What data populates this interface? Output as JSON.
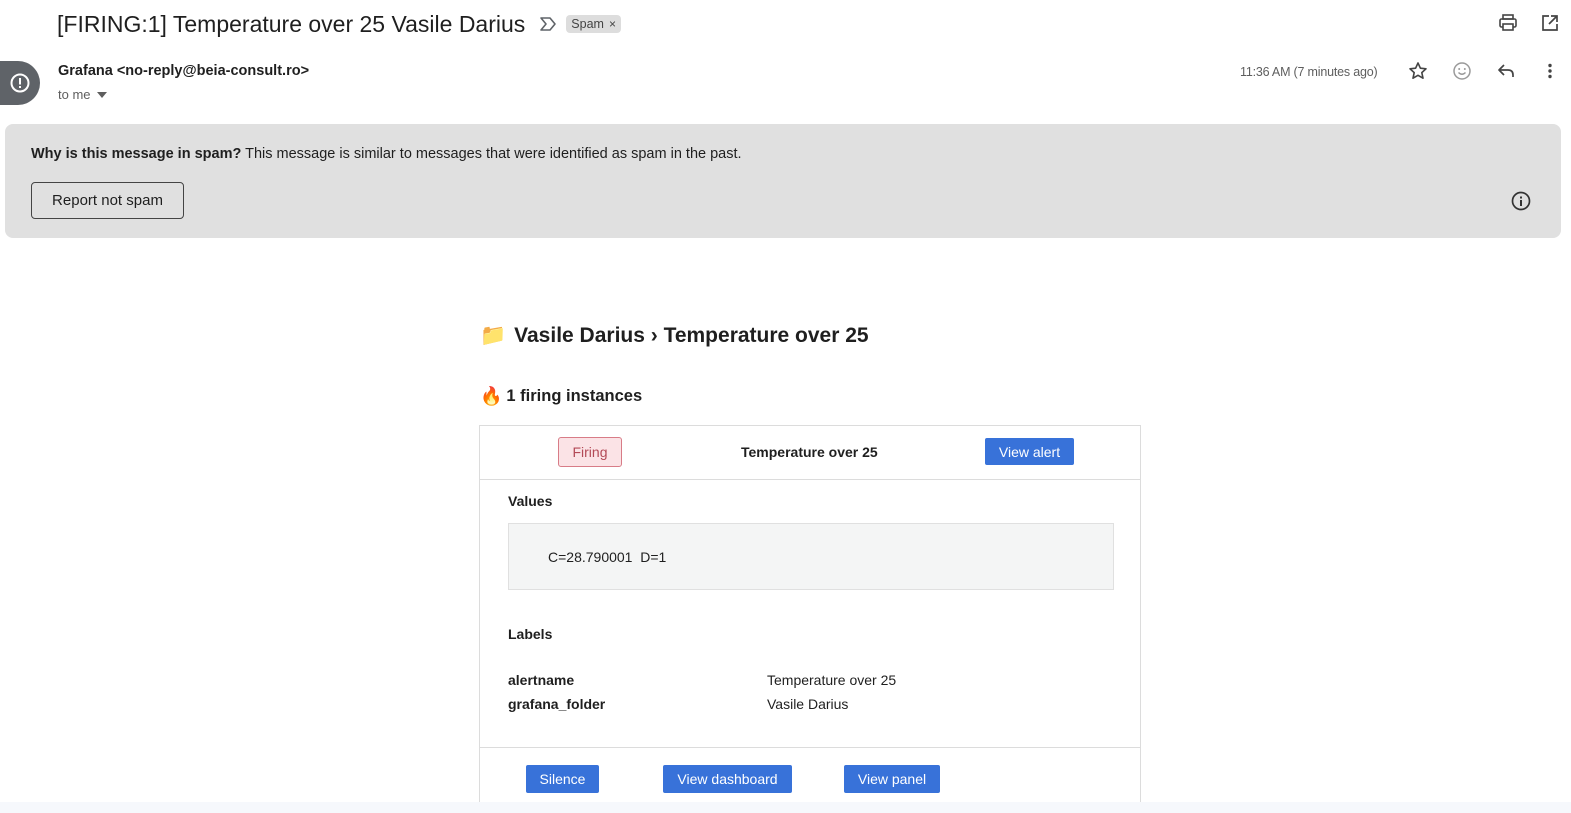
{
  "subject": {
    "text": "[FIRING:1] Temperature over 25 Vasile Darius",
    "label_chip": "Spam",
    "label_chip_close": "×"
  },
  "sender": {
    "name_email": "Grafana <no-reply@beia-consult.ro>",
    "recipient": "to me",
    "timestamp": "11:36 AM (7 minutes ago)"
  },
  "spam_banner": {
    "question": "Why is this message in spam?",
    "explanation": " This message is similar to messages that were identified as spam in the past.",
    "report_button": "Report not spam"
  },
  "email": {
    "title": "Vasile Darius › Temperature over 25",
    "title_emoji": "📁",
    "firing_emoji": "🔥",
    "firing_count": "1 firing instances",
    "alert": {
      "status": "Firing",
      "name": "Temperature over 25",
      "view_alert": "View alert",
      "values_heading": "Values",
      "values": "C=28.790001  D=1",
      "labels_heading": "Labels",
      "labels": [
        {
          "key": "alertname",
          "value": "Temperature over 25"
        },
        {
          "key": "grafana_folder",
          "value": "Vasile Darius"
        }
      ],
      "silence": "Silence",
      "view_dashboard": "View dashboard",
      "view_panel": "View panel"
    }
  },
  "colors": {
    "primary_button": "#3872d9",
    "firing_badge_bg": "#fbe3e6",
    "firing_badge_border": "#d87c87",
    "spam_banner_bg": "#e0e0e0",
    "avatar_bg": "#5f6368"
  },
  "icons": {
    "top_actions": [
      "print-icon",
      "open-in-new-window-icon"
    ],
    "message_actions": [
      "star-icon",
      "emoji-reaction-icon",
      "reply-icon",
      "more-vert-icon"
    ]
  }
}
